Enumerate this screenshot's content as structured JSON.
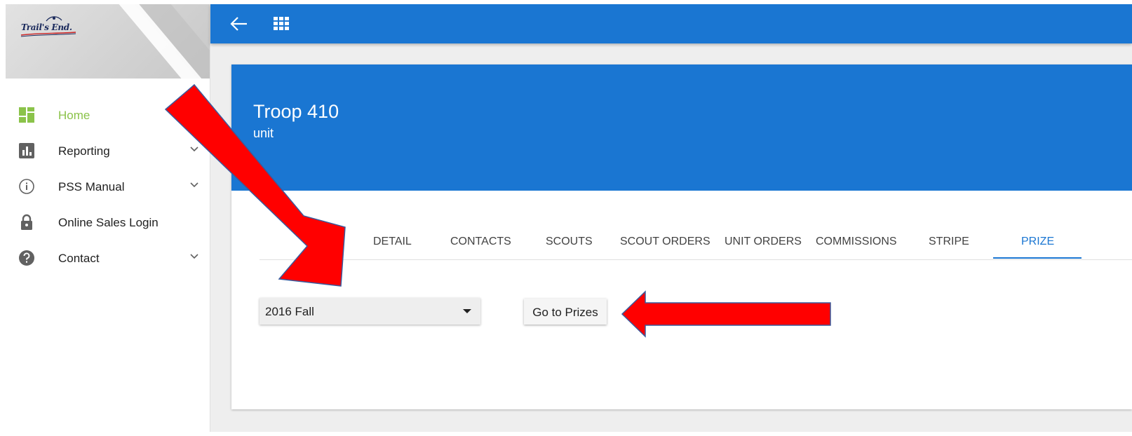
{
  "brand": {
    "logo_text": "Trail's End."
  },
  "sidebar": {
    "items": [
      {
        "label": "Home",
        "icon": "dashboard-icon",
        "active": true
      },
      {
        "label": "Reporting",
        "icon": "bar-chart-icon",
        "expandable": true
      },
      {
        "label": "PSS Manual",
        "icon": "info-icon",
        "expandable": true
      },
      {
        "label": "Online Sales Login",
        "icon": "lock-icon"
      },
      {
        "label": "Contact",
        "icon": "help-icon",
        "expandable": true
      }
    ]
  },
  "topbar": {
    "back_icon": "arrow-left-icon",
    "apps_icon": "grid-icon"
  },
  "card": {
    "title": "Troop 410",
    "subtitle": "unit",
    "tabs": [
      {
        "label": "DETAIL"
      },
      {
        "label": "CONTACTS"
      },
      {
        "label": "SCOUTS"
      },
      {
        "label": "SCOUT ORDERS"
      },
      {
        "label": "UNIT ORDERS"
      },
      {
        "label": "COMMISSIONS"
      },
      {
        "label": "STRIPE"
      },
      {
        "label": "PRIZE",
        "active": true
      }
    ],
    "season_select": {
      "value": "2016 Fall"
    },
    "go_button_label": "Go to Prizes"
  },
  "colors": {
    "primary": "#1a76d2",
    "active_nav": "#8bc34a",
    "annotation_arrow": "#ff0000",
    "annotation_outline": "#3a5a9c"
  }
}
